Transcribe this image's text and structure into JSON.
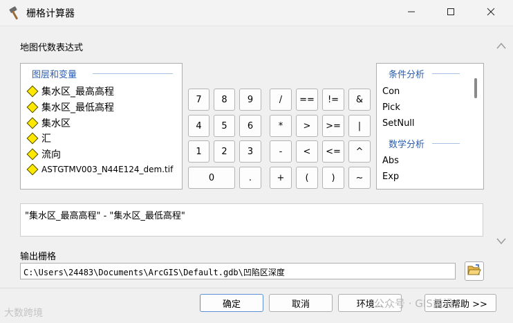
{
  "window": {
    "title": "栅格计算器"
  },
  "expression_section": {
    "label": "地图代数表达式"
  },
  "layers": {
    "heading": "图层和变量",
    "items": [
      "集水区_最高高程",
      "集水区_最低高程",
      "集水区",
      "汇",
      "流向",
      "ASTGTMV003_N44E124_dem.tif"
    ]
  },
  "keypad": {
    "keys": [
      "7",
      "8",
      "9",
      "/",
      "==",
      "!=",
      "&",
      "4",
      "5",
      "6",
      "*",
      ">",
      ">=",
      "|",
      "1",
      "2",
      "3",
      "-",
      "<",
      "<=",
      "^",
      "0",
      ".",
      "+",
      "(",
      ")",
      "~"
    ]
  },
  "functions": {
    "groups": [
      {
        "heading": "条件分析",
        "items": [
          "Con",
          "Pick",
          "SetNull"
        ]
      },
      {
        "heading": "数学分析",
        "items": [
          "Abs",
          "Exp"
        ]
      }
    ]
  },
  "expression": {
    "value": "\"集水区_最高高程\" - \"集水区_最低高程\""
  },
  "output": {
    "label": "输出栅格",
    "path": "C:\\Users\\24483\\Documents\\ArcGIS\\Default.gdb\\凹陷区深度"
  },
  "buttons": {
    "ok": "确定",
    "cancel": "取消",
    "environments": "环境...",
    "help": "显示帮助 >>"
  },
  "watermarks": {
    "left": "大数跨境",
    "right": "公众号 · GIS前沿"
  },
  "icons": {
    "app": "hammer-icon",
    "minimize": "minimize-icon",
    "maximize": "maximize-icon",
    "close": "close-icon",
    "folder": "open-folder-icon"
  },
  "colors": {
    "group_heading": "#2a5db0",
    "layer_diamond": "#ffe800"
  }
}
